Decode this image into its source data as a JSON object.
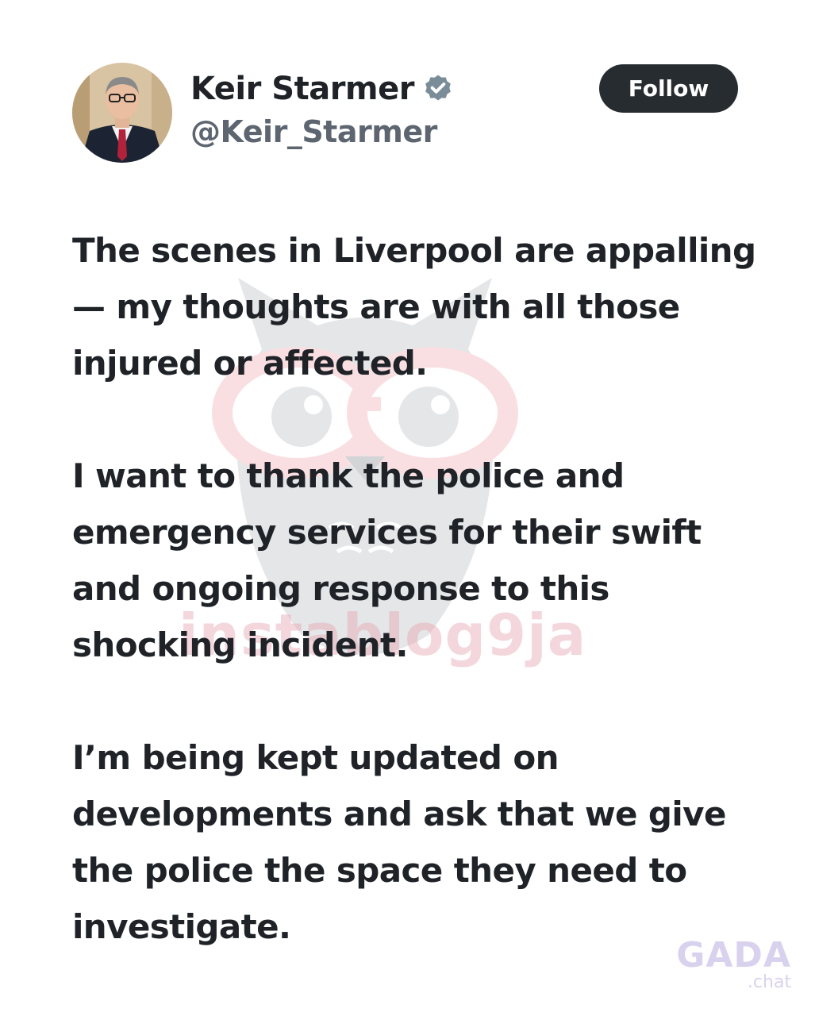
{
  "author": {
    "display_name": "Keir Starmer",
    "handle": "@Keir_Starmer",
    "verified": true,
    "avatar_icon": "person-portrait-avatar"
  },
  "follow_button": {
    "label": "Follow",
    "background": "#272c31",
    "text_color": "#ffffff"
  },
  "tweet": {
    "paragraphs": [
      "The scenes in Liverpool are appalling — my thoughts are with all those injured or affected.",
      "I want to thank the police and emergency services for their swift and ongoing response to this shocking incident.",
      "I’m being kept updated on developments and ask that we give the police the space they need to investigate."
    ]
  },
  "watermark": {
    "text": "instablog9ja",
    "icon": "owl-with-glasses-watermark"
  },
  "site_logo": {
    "main": "GADA",
    "sub": ".chat"
  },
  "colors": {
    "text_primary": "#1f2328",
    "text_secondary": "#5c6570",
    "verified_badge": "#7b8c99"
  }
}
